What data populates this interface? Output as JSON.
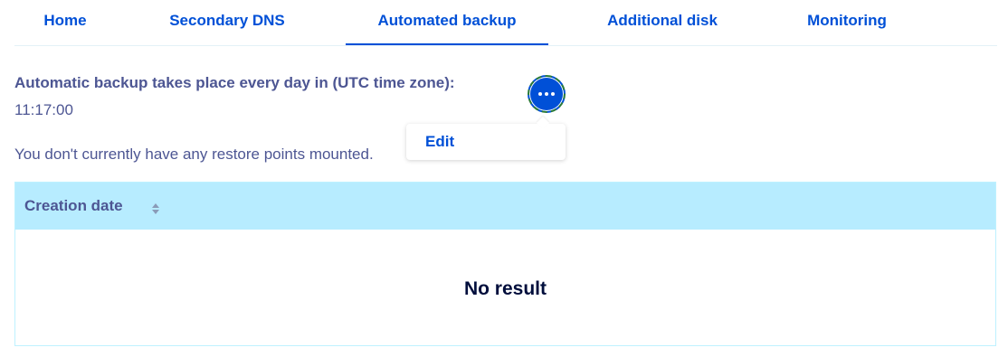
{
  "tabs": [
    {
      "label": "Home"
    },
    {
      "label": "Secondary DNS"
    },
    {
      "label": "Automated backup"
    },
    {
      "label": "Additional disk"
    },
    {
      "label": "Monitoring"
    }
  ],
  "backup": {
    "heading": "Automatic backup takes place every day in (UTC time zone):",
    "time": "11:17:00",
    "restore_message": "You don't currently have any restore points mounted."
  },
  "actions": {
    "menu_icon": "ellipsis-icon",
    "edit_label": "Edit"
  },
  "table": {
    "columns": [
      {
        "label": "Creation date",
        "icon": "sort-icon"
      }
    ],
    "empty_message": "No result"
  },
  "colors": {
    "accent": "#0050d7",
    "text": "#4d5693",
    "table_header_bg": "#b7ecff",
    "focus_outline": "#2a7a37"
  }
}
